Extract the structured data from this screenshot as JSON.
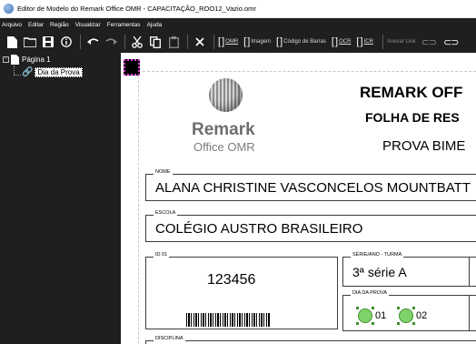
{
  "window": {
    "title": "Editor de Modelo do Remark Office OMR - CAPACITAÇÃO_ROO12_Vazio.omr"
  },
  "menu": {
    "items": [
      "Arquivo",
      "Editar",
      "Região",
      "Visualizar",
      "Ferramentas",
      "Ajuda"
    ]
  },
  "toolbar": {
    "new_icon": "new-document-icon",
    "open_icon": "folder-open-icon",
    "save_icon": "save-icon",
    "info_icon": "info-icon",
    "undo_icon": "undo-icon",
    "redo_icon": "redo-icon",
    "cut_icon": "scissors-icon",
    "copy_icon": "copy-icon",
    "paste_icon": "paste-icon",
    "delete_icon": "delete-icon",
    "omr": "OMR",
    "imagem": "Imagem",
    "codigo_barras": "Código de Barras",
    "ocr": "OCR",
    "icr": "ICR",
    "anexar_link": "Anexar Link"
  },
  "tree": {
    "page": "Página 1",
    "child": "Dia da Prova"
  },
  "form": {
    "logo_word": "Remark",
    "logo_sub": "Office OMR",
    "heading1": "REMARK OFF",
    "heading2": "FOLHA DE RES",
    "heading3": "PROVA BIME",
    "nome_label": "NOME",
    "nome_value": "ALANA CHRISTINE VASCONCELOS  MOUNTBATT",
    "escola_label": "ESCOLA",
    "escola_value": "COLÉGIO AUSTRO BRASILEIRO",
    "id_label": "ID 01",
    "id_value": "123456",
    "serie_label": "SÉRIE/ANO - TURMA",
    "serie_value": "3ª série A",
    "dia_label": "DIA DA PROVA",
    "dia_options": [
      "01",
      "02"
    ],
    "disciplina_label": "DISCIPLINA"
  },
  "colors": {
    "dark_bg": "#1f1f1f",
    "selection_magenta": "#e23be2",
    "omr_green": "#7fd36a"
  }
}
